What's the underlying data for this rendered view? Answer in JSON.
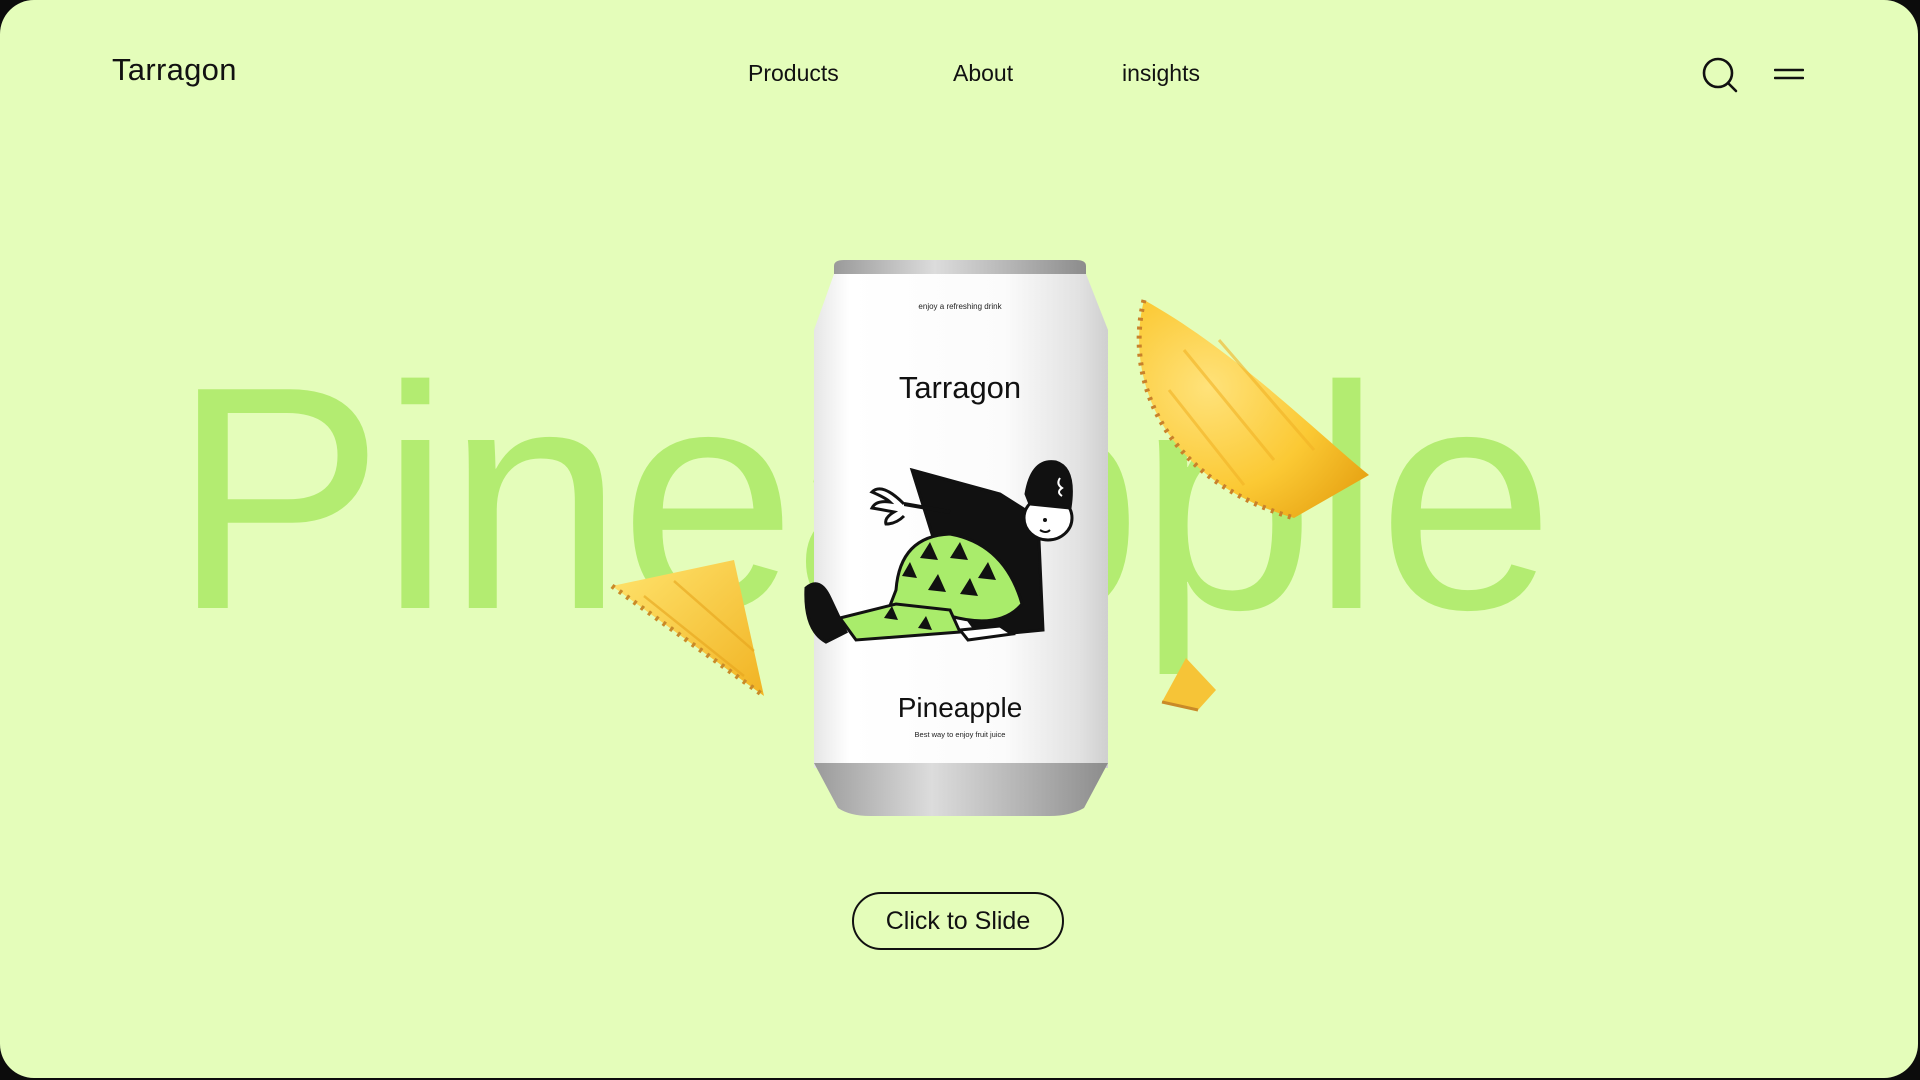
{
  "header": {
    "logo": "Tarragon",
    "nav": [
      {
        "label": "Products"
      },
      {
        "label": "About"
      },
      {
        "label": "insights"
      }
    ],
    "icons": [
      "search-icon",
      "menu-icon"
    ]
  },
  "hero": {
    "background_word": "Pineapple",
    "can": {
      "top_label": "enjoy a refreshing drink",
      "brand": "Tarragon",
      "flavor": "Pineapple",
      "tagline": "Best way to enjoy fruit juice"
    },
    "cta_label": "Click to Slide"
  },
  "colors": {
    "background": "#e4fdba",
    "accent_word": "#b3ec71",
    "character_green": "#a9ec6b",
    "text": "#111111"
  }
}
